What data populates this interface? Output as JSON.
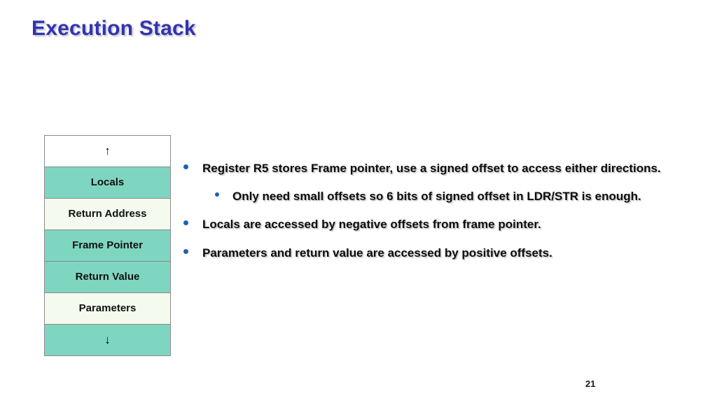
{
  "slide": {
    "title": "Execution Stack",
    "page_number": "21"
  },
  "colors": {
    "title_blue": "#3333b0",
    "cell_teal": "#7fd6c0",
    "cell_cream": "#f4fbee",
    "cell_white": "#ffffff",
    "bullet_blue": "#1f5fae",
    "background": "#ffffff"
  },
  "stack_diagram": {
    "name": "execution-stack-diagram",
    "rows": [
      {
        "label": "↑",
        "fill": "white",
        "kind": "arrow-up"
      },
      {
        "label": "Locals",
        "fill": "teal",
        "kind": "segment"
      },
      {
        "label": "Return Address",
        "fill": "cream",
        "kind": "segment"
      },
      {
        "label": "Frame Pointer",
        "fill": "teal",
        "kind": "segment"
      },
      {
        "label": "Return Value",
        "fill": "teal",
        "kind": "segment"
      },
      {
        "label": "Parameters",
        "fill": "cream",
        "kind": "segment"
      },
      {
        "label": "↓",
        "fill": "teal",
        "kind": "arrow-down"
      }
    ]
  },
  "bullets": [
    {
      "level": 1,
      "text": "Register R5 stores Frame pointer, use a signed offset to access either directions."
    },
    {
      "level": 2,
      "text": "Only need small offsets so 6 bits of signed offset in LDR/STR is enough."
    },
    {
      "level": 1,
      "text": "Locals are accessed by negative offsets from frame pointer."
    },
    {
      "level": 1,
      "text": "Parameters and return value are accessed by positive offsets."
    }
  ]
}
